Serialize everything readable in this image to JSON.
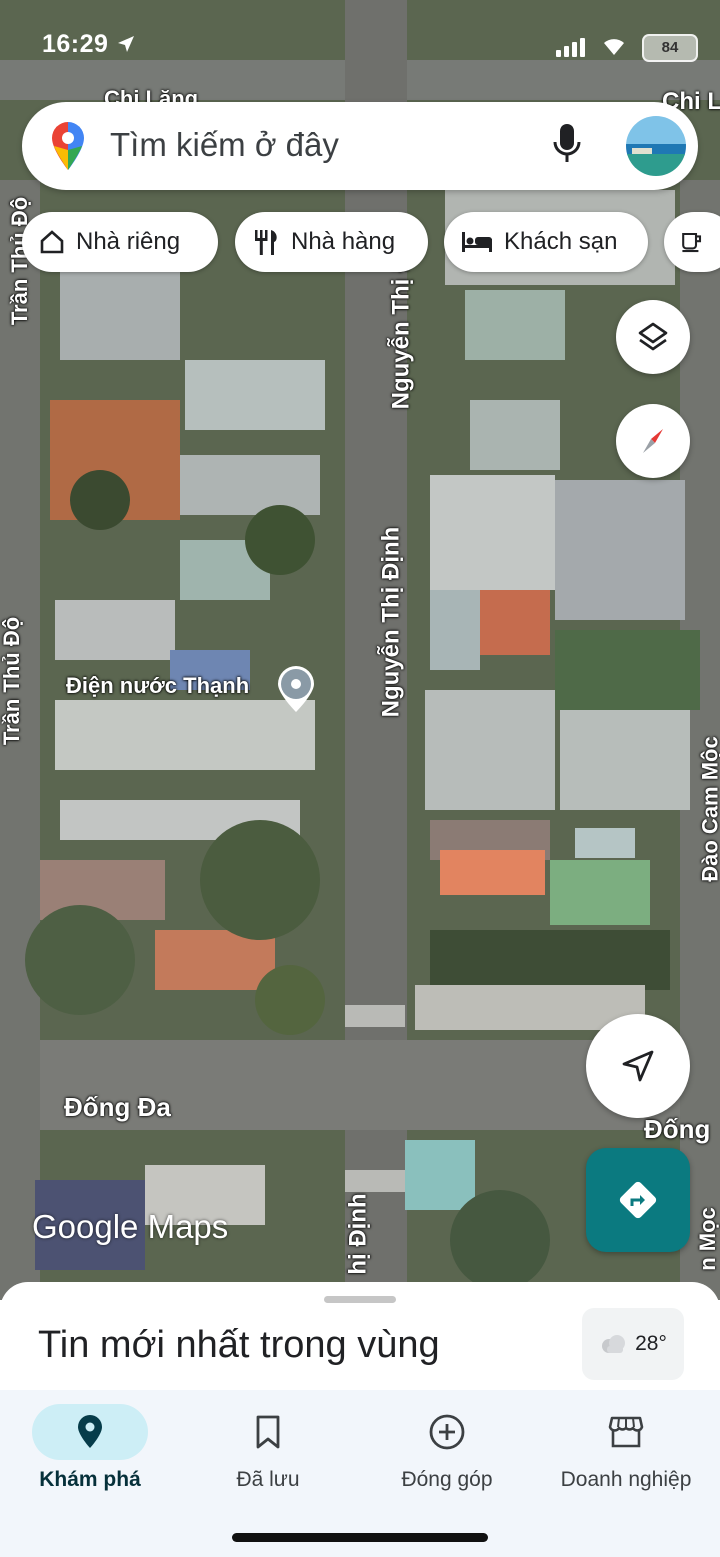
{
  "status_bar": {
    "time": "16:29",
    "battery": "84"
  },
  "search": {
    "placeholder": "Tìm kiếm ở đây"
  },
  "chips": [
    {
      "label": "Nhà riêng",
      "icon": "home-icon"
    },
    {
      "label": "Nhà hàng",
      "icon": "restaurant-icon"
    },
    {
      "label": "Khách sạn",
      "icon": "hotel-icon"
    },
    {
      "label": "",
      "icon": "coffee-icon"
    }
  ],
  "map": {
    "place_label": "Điện nước Thạnh",
    "streets": {
      "tran_thu_do_top": "Trần Thủ Độ",
      "tran_thu_do_mid": "Trần Thủ Độ",
      "nguyen_thi_dinh_top": "Nguyễn Thị Định",
      "nguyen_thi_dinh_mid": "Nguyễn Thị Định",
      "nguyen_thi_dinh_bottom": "hị Định",
      "dao_cam_moc": "Đào Cam Mộc",
      "dao_cam_moc_bottom": "n Mọc",
      "dong_da_left": "Đống Đa",
      "dong_da_right": "Đống",
      "chi_lang_left": "Chi Lăng",
      "chi_lang_right": "Chi L"
    },
    "watermark": "Google Maps",
    "brand_color": "#0b7a80"
  },
  "sheet": {
    "title": "Tin mới nhất trong vùng",
    "temperature": "28°"
  },
  "nav": [
    {
      "label": "Khám phá",
      "icon": "explore-pin-icon",
      "active": true
    },
    {
      "label": "Đã lưu",
      "icon": "bookmark-icon",
      "active": false
    },
    {
      "label": "Đóng góp",
      "icon": "add-circle-icon",
      "active": false
    },
    {
      "label": "Doanh nghiệp",
      "icon": "storefront-icon",
      "active": false
    }
  ]
}
